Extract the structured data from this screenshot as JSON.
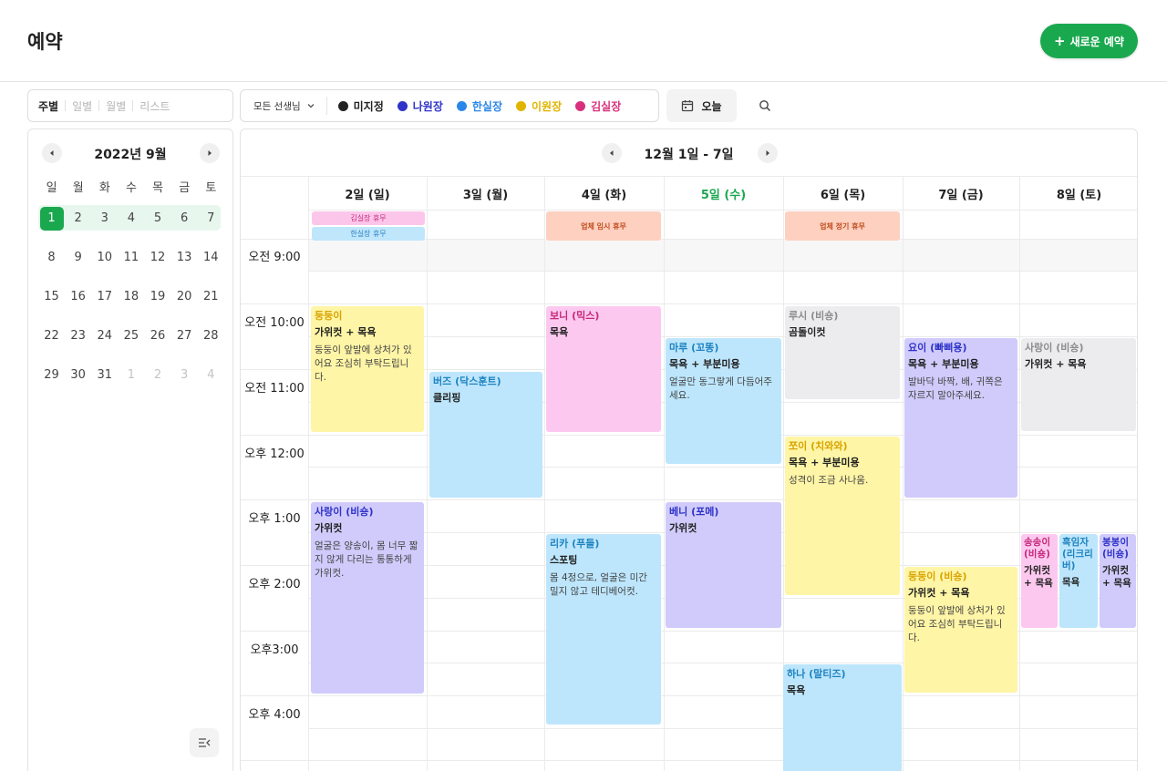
{
  "header": {
    "title": "예약",
    "new_button": "새로운 예약"
  },
  "view_tabs": [
    "주별",
    "일별",
    "월별",
    "리스트"
  ],
  "filter": {
    "teacher_select": "모든 선생님",
    "legend": [
      {
        "label": "미지정",
        "color": "#222222"
      },
      {
        "label": "나원장",
        "color": "#2f33c8"
      },
      {
        "label": "한실장",
        "color": "#2a86e8"
      },
      {
        "label": "이원장",
        "color": "#e0b400"
      },
      {
        "label": "김실장",
        "color": "#d8307c"
      }
    ]
  },
  "today_button": "오늘",
  "mini_calendar": {
    "title": "2022년 9월",
    "weekdays": [
      "일",
      "월",
      "화",
      "수",
      "목",
      "금",
      "토"
    ],
    "weeks": [
      [
        "1",
        "2",
        "3",
        "4",
        "5",
        "6",
        "7"
      ],
      [
        "8",
        "9",
        "10",
        "11",
        "12",
        "13",
        "14"
      ],
      [
        "15",
        "16",
        "17",
        "18",
        "19",
        "20",
        "21"
      ],
      [
        "22",
        "23",
        "24",
        "25",
        "26",
        "27",
        "28"
      ],
      [
        "29",
        "30",
        "31",
        "1",
        "2",
        "3",
        "4"
      ]
    ]
  },
  "week": {
    "title": "12월 1일 - 7일",
    "days": [
      "2일 (일)",
      "3일 (월)",
      "4일 (화)",
      "5일 (수)",
      "6일 (목)",
      "7일 (금)",
      "8일 (토)"
    ],
    "times": [
      "오전 9:00",
      "오전 10:00",
      "오전 11:00",
      "오후 12:00",
      "오후 1:00",
      "오후 2:00",
      "오후3:00",
      "오후 4:00"
    ],
    "closures": [
      {
        "label": "김실장 휴무"
      },
      {
        "label": "한실장 휴무"
      },
      {
        "label": "업체 임시 휴무"
      },
      {
        "label": "업체 정기 휴무"
      }
    ],
    "events": [
      {
        "name": "둥둥이",
        "service": "가위컷 + 목욕",
        "note": "둥둥이 앞발에 상처가 있어요 조심히 부탁드립니다."
      },
      {
        "name": "사랑이 (비숑)",
        "service": "가위컷",
        "note": "얼굴은 양송이, 몸 너무 짧지 않게 다리는 통통하게 가위컷."
      },
      {
        "name": "버즈 (닥스훈트)",
        "service": "클리핑",
        "note": ""
      },
      {
        "name": "보니 (믹스)",
        "service": "목욕",
        "note": ""
      },
      {
        "name": "리카 (푸들)",
        "service": "스포팅",
        "note": "몸 4정으로, 얼굴은 미간 밀지 않고 테디베어컷."
      },
      {
        "name": "마루 (꼬똥)",
        "service": "목욕 + 부분미용",
        "note": "얼굴만 동그랗게 다듬어주세요."
      },
      {
        "name": "베니 (포메)",
        "service": "가위컷",
        "note": ""
      },
      {
        "name": "루시 (비숑)",
        "service": "곰돌이컷",
        "note": ""
      },
      {
        "name": "쪼이 (치와와)",
        "service": "목욕 + 부분미용",
        "note": "성격이 조금 사나움."
      },
      {
        "name": "하나 (말티즈)",
        "service": "목욕",
        "note": ""
      },
      {
        "name": "요이 (빠삐용)",
        "service": "목욕 + 부분미용",
        "note": "발바닥 바짝, 배, 귀쪽은 자르지 말아주세요."
      },
      {
        "name": "둥둥이 (비숑)",
        "service": "가위컷 + 목욕",
        "note": "둥둥이 앞발에 상처가 있어요 조심히 부탁드립니다."
      },
      {
        "name": "사랑이 (비숑)",
        "service": "가위컷 + 목욕",
        "note": ""
      },
      {
        "name": "송송이 (비숑)",
        "service": "가위컷 + 목욕",
        "note": ""
      },
      {
        "name": "흑임자 (리크리버)",
        "service": "목욕",
        "note": ""
      },
      {
        "name": "봉봉이 (비숑)",
        "service": "가위컷 + 목욕",
        "note": ""
      }
    ]
  }
}
